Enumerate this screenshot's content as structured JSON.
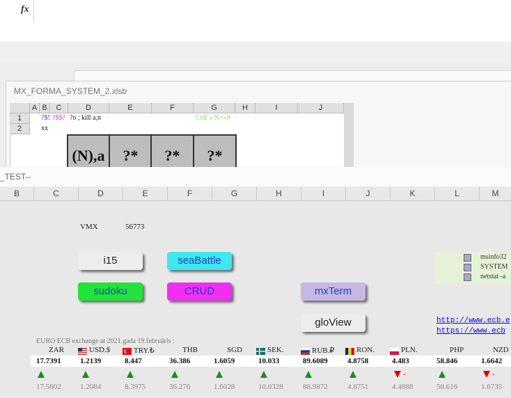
{
  "formula_bar": {
    "fx_label": "fx",
    "value": ""
  },
  "back_workbook": {
    "title": "MX_FORMA_SYSTEM_2.xlsb",
    "columns": [
      "A",
      "B",
      "C",
      "D",
      "E",
      "F",
      "G",
      "H",
      "I",
      "J"
    ],
    "rows": [
      "1",
      "2"
    ],
    "cells": {
      "b1": "?$!",
      "c1": "?$$?",
      "d1": "?o ; kill a,n",
      "g1": "?.x$' s N=»9",
      "b2": "xx",
      "d3": "(N),a",
      "e3": "?*",
      "f3": "?*",
      "g3": "?*"
    }
  },
  "front_workbook": {
    "title": "_TEST--",
    "columns": [
      "B",
      "C",
      "D",
      "E",
      "F",
      "G",
      "H",
      "I",
      "J",
      "K",
      "L",
      "M"
    ],
    "vmx_label": "VMX",
    "vmx_value": "56773",
    "buttons": {
      "i15": "i15",
      "seabattle": "seaBattle",
      "sudoku": "sudoku",
      "crud": "CRUD",
      "mxterm": "mxTerm",
      "gloview": "gloView"
    },
    "commands": [
      "msinfo32",
      "SYSTEM",
      "netstat -a"
    ],
    "links": [
      "http://www.ecb.e",
      "https://www.ecb"
    ],
    "ecb": {
      "caption": "EURO  ECB exchange at 2021.gada 19.februāris :",
      "currencies": [
        {
          "code": "ZAR",
          "rate": "17.7391",
          "prev": "17.5602",
          "trend": "up",
          "flag": "",
          "dash": ""
        },
        {
          "code": "USD.$",
          "rate": "1.2139",
          "prev": "1.2084",
          "trend": "up",
          "flag": "us",
          "dash": ""
        },
        {
          "code": "TRY.₺",
          "rate": "8.447",
          "prev": "8.3975",
          "trend": "up",
          "flag": "tr",
          "dash": ""
        },
        {
          "code": "THB",
          "rate": "36.386",
          "prev": "36.276",
          "trend": "up",
          "flag": "",
          "dash": ""
        },
        {
          "code": "SGD",
          "rate": "1.6059",
          "prev": "1.6028",
          "trend": "up",
          "flag": "",
          "dash": ""
        },
        {
          "code": "SEK.",
          "rate": "10.033",
          "prev": "10.0328",
          "trend": "up",
          "flag": "se",
          "dash": ""
        },
        {
          "code": "RUB.₽",
          "rate": "89.6089",
          "prev": "88.9872",
          "trend": "up",
          "flag": "ru",
          "dash": ""
        },
        {
          "code": "RON.",
          "rate": "4.8758",
          "prev": "4.8751",
          "trend": "up",
          "flag": "ro",
          "dash": ""
        },
        {
          "code": "PLN.",
          "rate": "4.483",
          "prev": "4.4888",
          "trend": "down",
          "flag": "pl",
          "dash": "-"
        },
        {
          "code": "PHP",
          "rate": "58.846",
          "prev": "58.616",
          "trend": "up",
          "flag": "",
          "dash": ""
        },
        {
          "code": "NZD",
          "rate": "1.6642",
          "prev": "1.6735",
          "trend": "down",
          "flag": "",
          "dash": "-"
        }
      ]
    }
  },
  "colors": {
    "btn_grey": "#ededed",
    "btn_cyan": "#3fe7ef",
    "btn_green": "#22e33a",
    "btn_magenta": "#f12ff1",
    "btn_lavender": "#c6b8e2",
    "trend_up": "#1a8f1a",
    "trend_down": "#e00000"
  }
}
